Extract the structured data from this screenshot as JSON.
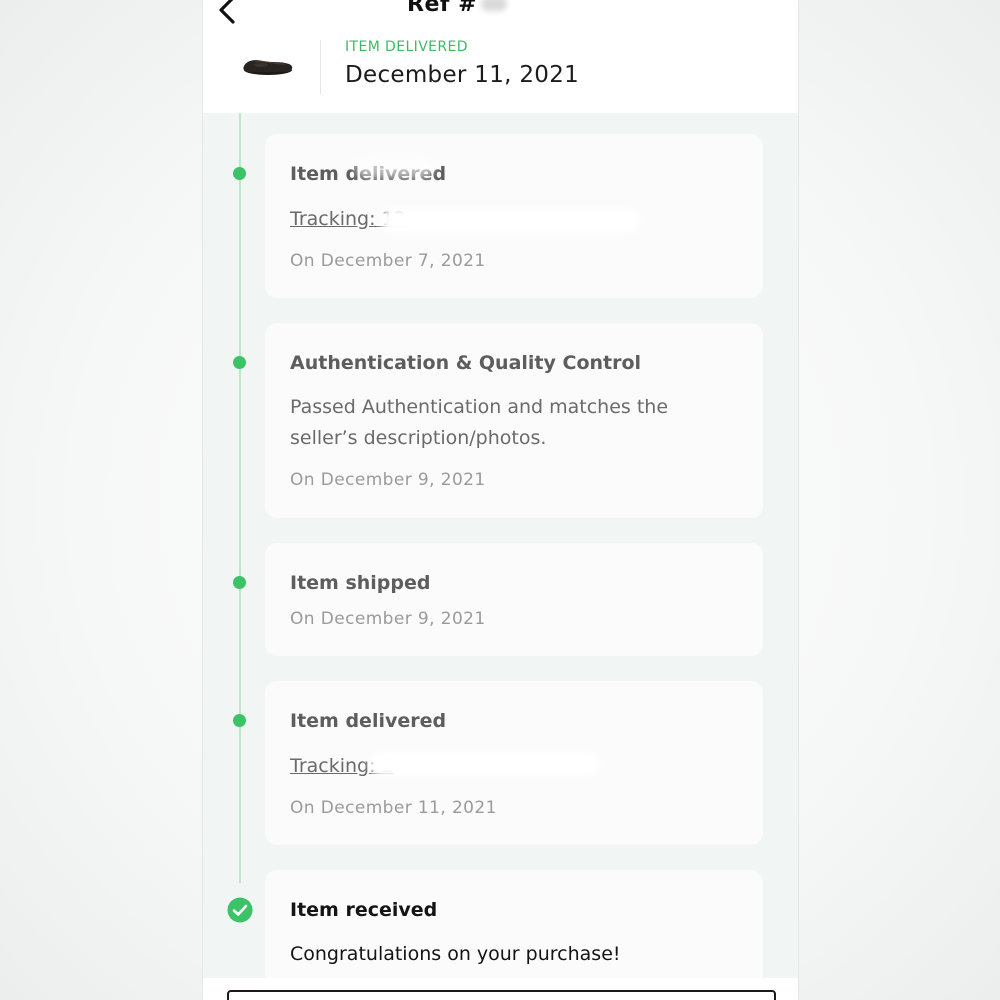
{
  "header": {
    "ref_label": "Ref #",
    "status_label": "ITEM DELIVERED",
    "status_date": "December 11, 2021"
  },
  "timeline": [
    {
      "title": "Item delivered",
      "body": "Tracking: 12",
      "date": "On December 7, 2021"
    },
    {
      "title": "Authentication & Quality Control",
      "body": "Passed Authentication and matches the seller’s description/photos.",
      "date": "On December 9, 2021"
    },
    {
      "title": "Item shipped",
      "date": "On December 9, 2021"
    },
    {
      "title": "Item delivered",
      "body": "Tracking: 2",
      "date": "On December 11, 2021"
    },
    {
      "title": "Item received",
      "body": "Congratulations on your purchase!"
    }
  ],
  "colors": {
    "accent_green": "#3cc267",
    "timeline_bg": "#f1f6f5",
    "card_bg": "#fbfbfb"
  },
  "icons": {
    "back": "chevron-left-icon",
    "done": "check-circle-icon",
    "product": "shoe-thumbnail"
  }
}
